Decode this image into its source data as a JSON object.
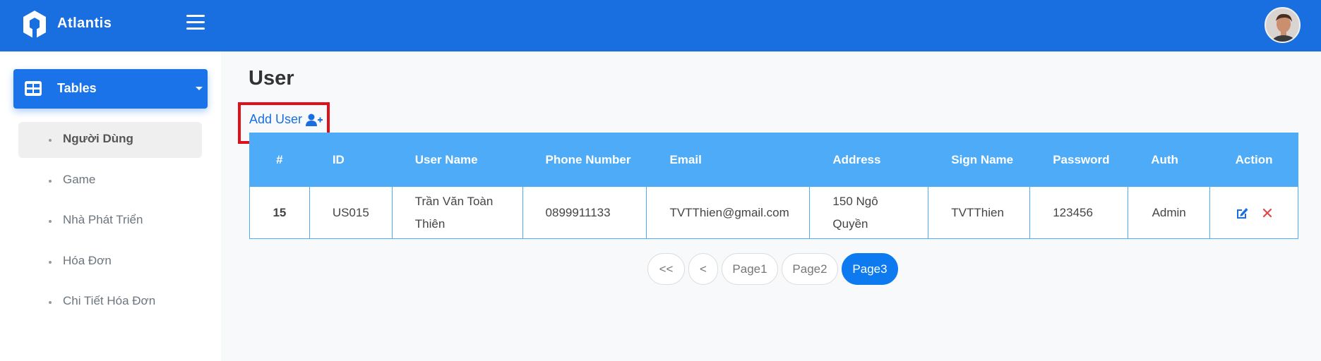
{
  "brand": {
    "name": "Atlantis"
  },
  "sidebar": {
    "active_menu": "Tables",
    "items": [
      {
        "label": "Người Dùng",
        "active": true
      },
      {
        "label": "Game",
        "active": false
      },
      {
        "label": "Nhà Phát Triển",
        "active": false
      },
      {
        "label": "Hóa Đơn",
        "active": false
      },
      {
        "label": "Chi Tiết Hóa Đơn",
        "active": false
      }
    ]
  },
  "main": {
    "title": "User",
    "add_user_label": "Add User",
    "table": {
      "headers": [
        "#",
        "ID",
        "User Name",
        "Phone Number",
        "Email",
        "Address",
        "Sign Name",
        "Password",
        "Auth",
        "Action"
      ],
      "rows": [
        {
          "num": "15",
          "id": "US015",
          "user_name": "Trần Văn Toàn Thiên",
          "phone": "0899911133",
          "email": "TVTThien@gmail.com",
          "address": "150 Ngô Quyền",
          "sign_name": "TVTThien",
          "password": "123456",
          "auth": "Admin"
        }
      ]
    },
    "pagination": {
      "first": "<<",
      "prev": "<",
      "pages": [
        "Page1",
        "Page2",
        "Page3"
      ],
      "current": "Page3"
    }
  },
  "colors": {
    "primary": "#1a6fe0",
    "table_header": "#4dabf7",
    "auth_admin": "#e04848",
    "highlight": "#e0101a",
    "active_page": "#0d7af0"
  }
}
